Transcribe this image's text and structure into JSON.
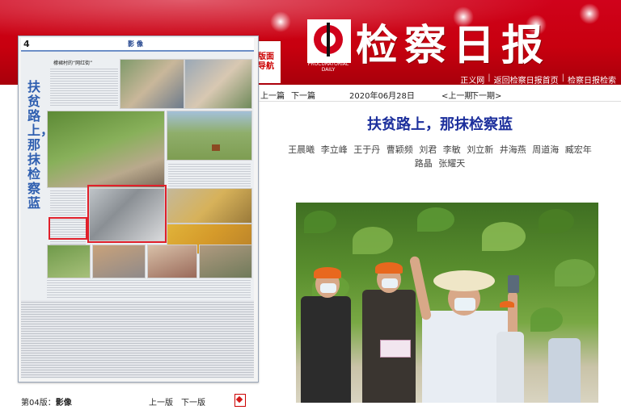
{
  "masthead": {
    "title": "检察日报",
    "subtitle": "PROCURATORIAL DAILY",
    "layout_nav_label": "版面导航"
  },
  "top_links": [
    "正义网",
    "返回检察日报首页",
    "检察日报检索"
  ],
  "newspaper_page": {
    "page_number": "4",
    "section": "影像",
    "vertical_title": "扶贫路上，那抹检察蓝",
    "inner_caption": "檬裙村的“网红街”"
  },
  "footer": {
    "page_label": "第04版：",
    "page_name": "影像",
    "prev_edition": "上一版",
    "next_edition": "下一版"
  },
  "article_nav": {
    "prev_article": "上一篇",
    "next_article": "下一篇",
    "date": "2020年06月28日",
    "prev_issue": "<上一期",
    "next_issue": "下一期>"
  },
  "article": {
    "title": "扶贫路上，那抹检察蓝",
    "authors": [
      "王晨曦",
      "李立峰",
      "王于丹",
      "曹颖频",
      "刘君",
      "李敏",
      "刘立新",
      "井海燕",
      "周道海",
      "臧宏年",
      "路晶",
      "张耀天"
    ]
  },
  "colors": {
    "header_red": "#d0021b",
    "title_blue": "#1c2f9c",
    "paper_title_blue": "#2f5fb0",
    "highlight_red": "#e0202b"
  }
}
